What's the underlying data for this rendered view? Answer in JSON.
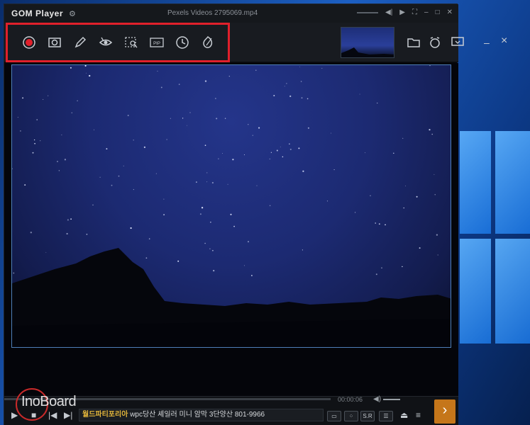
{
  "window": {
    "app_logo": "GOM Player",
    "title": "Pexels Videos 2795069.mp4",
    "title_controls": [
      "minimize-icon",
      "maximize-icon",
      "close-icon"
    ]
  },
  "toolbar": {
    "tools": [
      {
        "icon": "record-icon"
      },
      {
        "icon": "capture-icon"
      },
      {
        "icon": "pen-icon"
      },
      {
        "icon": "eye-icon"
      },
      {
        "icon": "region-capture-icon"
      },
      {
        "icon": "pip-icon",
        "label": "PIP"
      },
      {
        "icon": "clock-icon"
      },
      {
        "icon": "leaf-icon"
      }
    ],
    "right_icons": [
      "folder-icon",
      "alarm-icon",
      "screen-icon",
      "minimize-icon",
      "close-icon"
    ],
    "minimize_glyph": "–",
    "close_glyph": "×"
  },
  "player": {
    "time_total": "00:00:06",
    "subtitle_button": "S.R",
    "ticker_tag": "월드파티포리아",
    "ticker_text": "wpc당산 셰일러 미니 암막 3단양산 801-9966",
    "progress": 0.0
  },
  "watermark": {
    "text": "InoBoard"
  },
  "colors": {
    "highlight": "#e0202b",
    "next_button": "#c5761a"
  }
}
